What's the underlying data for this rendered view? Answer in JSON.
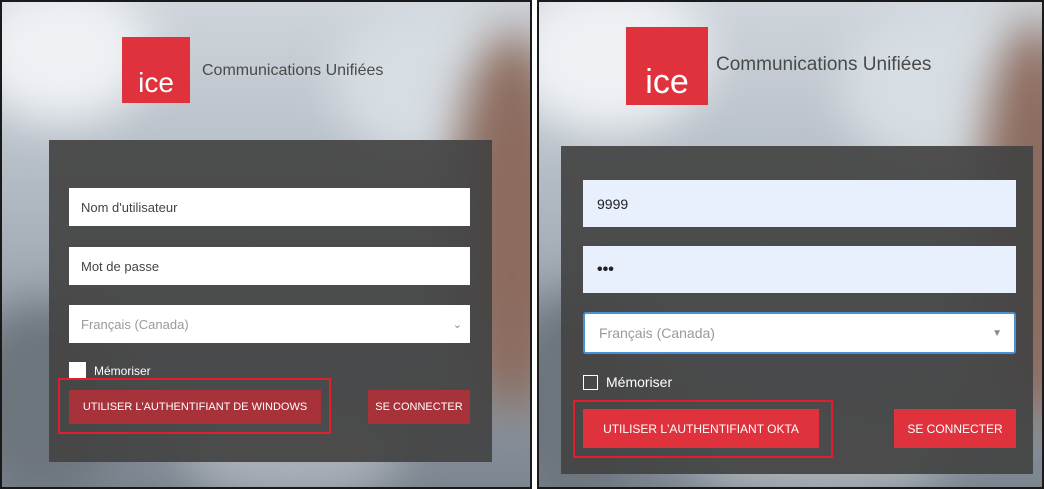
{
  "left": {
    "logo_text": "ice",
    "brand_title": "Communications Unifiées",
    "username_placeholder": "Nom d'utilisateur",
    "password_placeholder": "Mot de passe",
    "language_selected": "Français (Canada)",
    "remember_label": "Mémoriser",
    "auth_button_label": "UTILISER L'AUTHENTIFIANT DE WINDOWS",
    "connect_button_label": "SE CONNECTER"
  },
  "right": {
    "logo_text": "ice",
    "brand_title": "Communications Unifiées",
    "username_value": "9999",
    "password_value": "•••",
    "language_selected": "Français (Canada)",
    "remember_label": "Mémoriser",
    "auth_button_label": "UTILISER L'AUTHENTIFIANT OKTA",
    "connect_button_label": "SE CONNECTER"
  },
  "colors": {
    "brand_red": "#e0323d",
    "connect_left": "#a8323a",
    "connect_right": "#e0323d",
    "highlight": "#e21e2d"
  },
  "icons": {
    "dropdown_left": "chevron-down-icon",
    "dropdown_right": "caret-down-icon"
  }
}
